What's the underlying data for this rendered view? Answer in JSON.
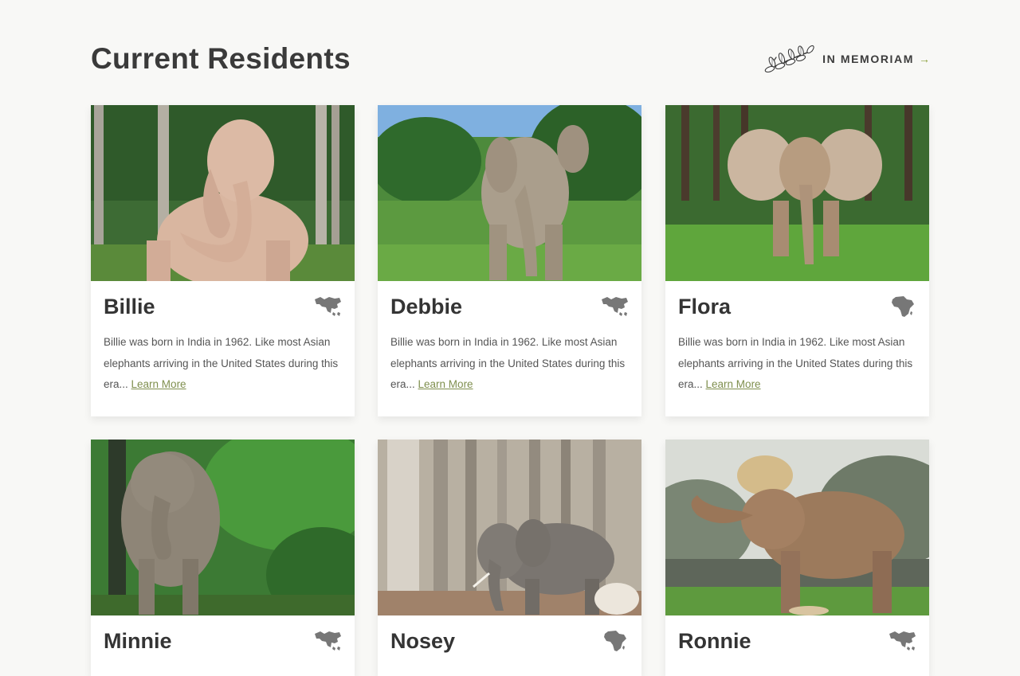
{
  "page_title": "Current Residents",
  "memoriam": {
    "label": "IN MEMORIAM",
    "arrow": "→",
    "icon": "laurel-branch-icon"
  },
  "residents": [
    {
      "name": "Billie",
      "continent_icon": "asia-map-icon",
      "description": "Billie was born in India in 1962. Like most Asian elephants arriving in the United States during this era...",
      "link_label": "Learn More"
    },
    {
      "name": "Debbie",
      "continent_icon": "asia-map-icon",
      "description": "Billie was born in India in 1962. Like most Asian elephants arriving in the United States during this era...",
      "link_label": "Learn More"
    },
    {
      "name": "Flora",
      "continent_icon": "africa-map-icon",
      "description": "Billie was born in India in 1962. Like most Asian elephants arriving in the United States during this era...",
      "link_label": "Learn More"
    },
    {
      "name": "Minnie",
      "continent_icon": "asia-map-icon"
    },
    {
      "name": "Nosey",
      "continent_icon": "africa-map-icon"
    },
    {
      "name": "Ronnie",
      "continent_icon": "asia-map-icon"
    }
  ],
  "colors": {
    "background": "#f8f8f6",
    "link": "#7f8f4e",
    "arrow": "#8aa03a",
    "text": "#343434"
  }
}
